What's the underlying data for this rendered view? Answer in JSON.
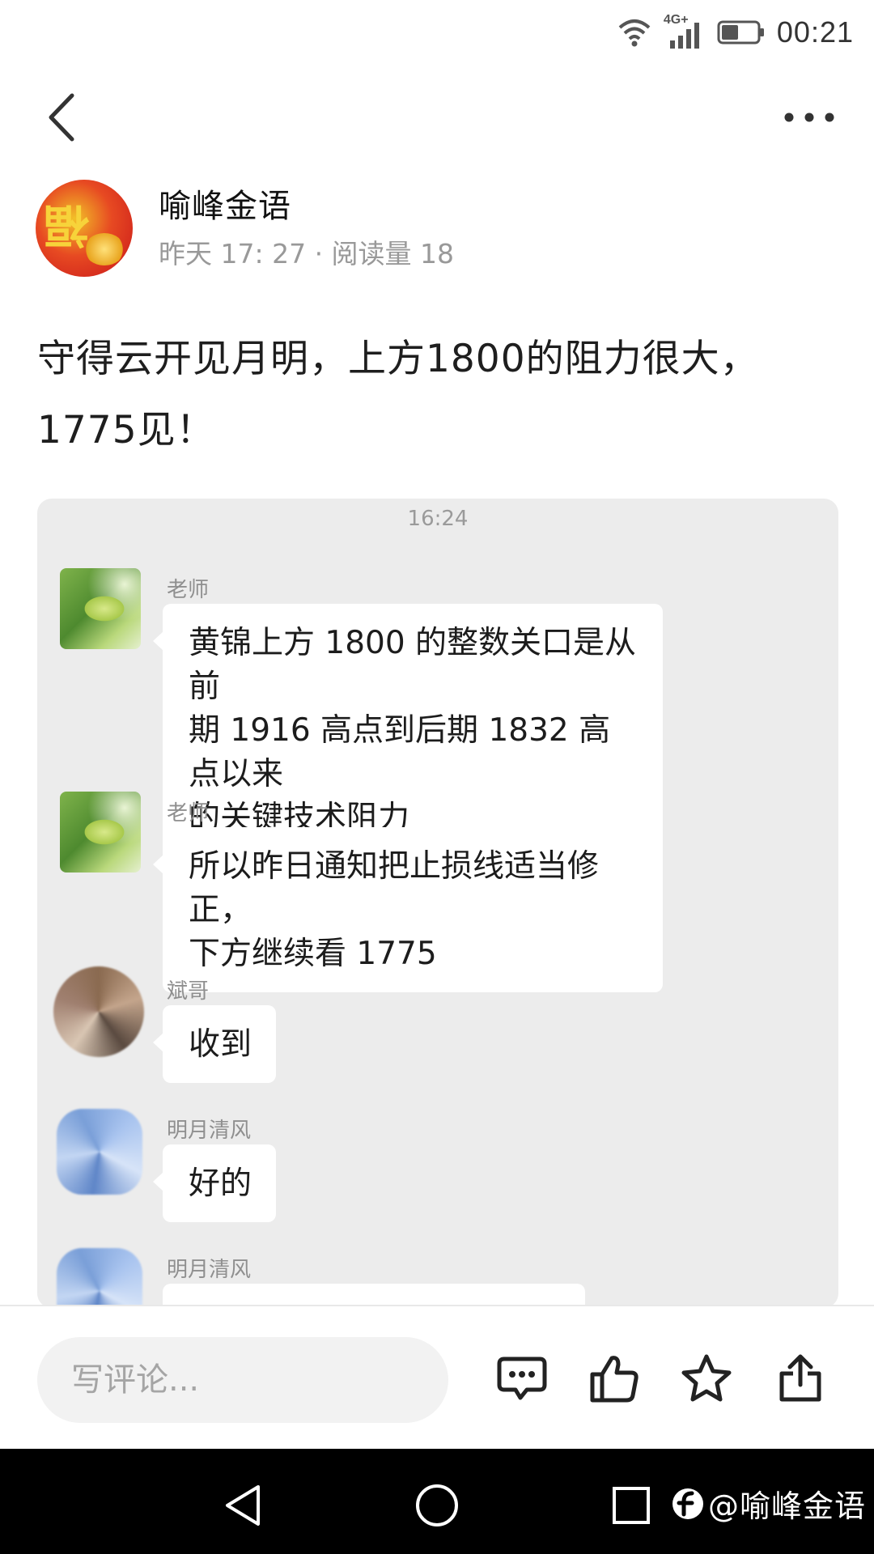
{
  "status_bar": {
    "network_label": "4G+",
    "time": "00:21"
  },
  "nav": {
    "back_icon": "chevron-left-icon",
    "more_icon": "more-horizontal-icon"
  },
  "post": {
    "author_name": "喻峰金语",
    "meta": "昨天 17: 27 · 阅读量 18",
    "text_line1": "守得云开见月明，上方1800的阻力很大，",
    "text_line2": "1775见！"
  },
  "chat": {
    "timestamp": "16:24",
    "messages": [
      {
        "sender": "老师",
        "lines": [
          "黄锦上方 1800 的整数关口是从前",
          "期 1916 高点到后期 1832 高点以来",
          "的关键技术阻力"
        ]
      },
      {
        "sender": "老师",
        "lines": [
          "所以昨日通知把止损线适当修正，",
          "下方继续看 1775"
        ]
      },
      {
        "sender": "斌哥",
        "lines": [
          "收到"
        ]
      },
      {
        "sender": "明月清风",
        "lines": [
          "好的"
        ]
      },
      {
        "sender": "明月清风",
        "lines": []
      }
    ]
  },
  "comment_bar": {
    "placeholder": "写评论...",
    "icons": [
      "comment-icon",
      "thumbs-up-icon",
      "star-icon",
      "share-icon"
    ]
  },
  "system_nav": {
    "icons": [
      "back-triangle-icon",
      "home-circle-icon",
      "recents-square-icon"
    ],
    "watermark": "@喻峰金语"
  }
}
